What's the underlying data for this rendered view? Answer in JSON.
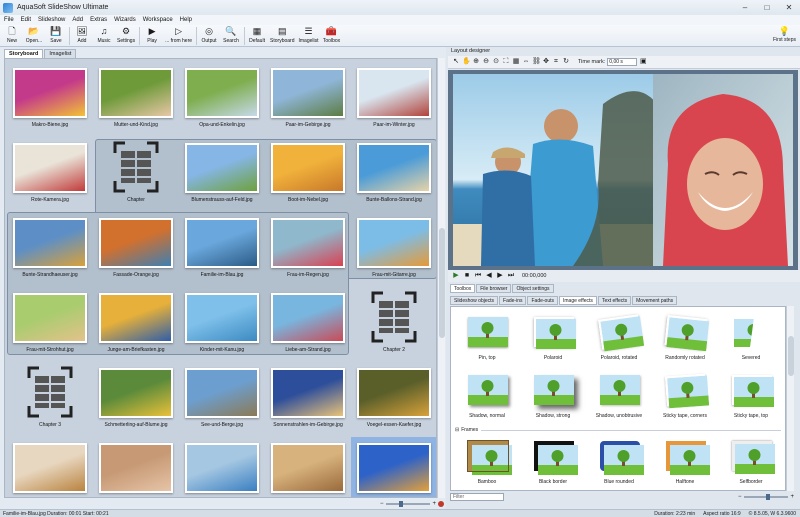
{
  "window": {
    "title": "AquaSoft SlideShow Ultimate",
    "minimize": "–",
    "maximize": "□",
    "close": "✕"
  },
  "menu": [
    "File",
    "Edit",
    "Slideshow",
    "Add",
    "Extras",
    "Wizards",
    "Workspace",
    "Help"
  ],
  "toolbar": [
    {
      "label": "New",
      "icon": "new-file-icon",
      "glyph": "🗋"
    },
    {
      "label": "Open...",
      "icon": "open-folder-icon",
      "glyph": "📂"
    },
    {
      "label": "Save",
      "icon": "save-icon",
      "glyph": "💾"
    },
    {
      "label": "Add",
      "icon": "add-image-icon",
      "glyph": "🖼"
    },
    {
      "label": "Music",
      "icon": "music-icon",
      "glyph": "♫"
    },
    {
      "label": "Settings",
      "icon": "settings-gear-icon",
      "glyph": "⚙"
    },
    {
      "label": "Play",
      "icon": "play-icon",
      "glyph": "▶"
    },
    {
      "label": "... from here",
      "icon": "play-from-here-icon",
      "glyph": "▷"
    },
    {
      "label": "Output",
      "icon": "output-icon",
      "glyph": "◎"
    },
    {
      "label": "Search",
      "icon": "search-icon",
      "glyph": "🔍"
    },
    {
      "label": "Default",
      "icon": "default-layout-icon",
      "glyph": "▦"
    },
    {
      "label": "Storyboard",
      "icon": "storyboard-icon",
      "glyph": "▤"
    },
    {
      "label": "Imagelist",
      "icon": "imagelist-icon",
      "glyph": "☰"
    },
    {
      "label": "Toolbox",
      "icon": "toolbox-icon",
      "glyph": "🧰"
    }
  ],
  "first_steps": {
    "label": "First steps",
    "icon": "lightbulb-icon",
    "glyph": "💡"
  },
  "left_tabs": [
    "Storyboard",
    "Imagelist"
  ],
  "storyboard": [
    {
      "caption": "Makro-Biene.jpg",
      "type": "photo",
      "c1": "#c43a8a",
      "c2": "#f2c236"
    },
    {
      "caption": "Mutter-und-Kind.jpg",
      "type": "photo",
      "c1": "#6e9a3a",
      "c2": "#e8c7a7"
    },
    {
      "caption": "Opa-und-Enkelin.jpg",
      "type": "photo",
      "c1": "#7fae4f",
      "c2": "#c7d9ea"
    },
    {
      "caption": "Paar-im-Gebirge.jpg",
      "type": "photo",
      "c1": "#8fb6d8",
      "c2": "#5d7c43"
    },
    {
      "caption": "Paar-im-Winter.jpg",
      "type": "photo",
      "c1": "#d9e6f0",
      "c2": "#b2433a"
    },
    {
      "caption": "Rote-Kamera.jpg",
      "type": "photo",
      "c1": "#e9e3d8",
      "c2": "#c13a3a"
    },
    {
      "caption": "Chapter",
      "type": "chapter"
    },
    {
      "caption": "Blumenstrauss-auf-Feld.jpg",
      "type": "photo",
      "c1": "#86b6e6",
      "c2": "#6ea13c"
    },
    {
      "caption": "Boot-im-Nebel.jpg",
      "type": "photo",
      "c1": "#f1b23b",
      "c2": "#c8782a"
    },
    {
      "caption": "Bunte-Ballons-Strand.jpg",
      "type": "photo",
      "c1": "#4a9bd8",
      "c2": "#e6d3a8"
    },
    {
      "caption": "Bunte-Strandhaeuser.jpg",
      "type": "photo",
      "c1": "#5d8fc6",
      "c2": "#d9a13a"
    },
    {
      "caption": "Fassade-Orange.jpg",
      "type": "photo",
      "c1": "#d2702e",
      "c2": "#3f7fb1"
    },
    {
      "caption": "Familie-im-Blau.jpg",
      "type": "photo",
      "c1": "#6aa7dc",
      "c2": "#2b5b86"
    },
    {
      "caption": "Frau-im-Regen.jpg",
      "type": "photo",
      "c1": "#8fb8cc",
      "c2": "#d84152"
    },
    {
      "caption": "Frau-mit-Gitarre.jpg",
      "type": "photo",
      "c1": "#7cbde8",
      "c2": "#e79a37"
    },
    {
      "caption": "Frau-mit-Strohhut.jpg",
      "type": "photo",
      "c1": "#a9cc6f",
      "c2": "#e3c28b"
    },
    {
      "caption": "Junge-am-Briefkasten.jpg",
      "type": "photo",
      "c1": "#e6b03a",
      "c2": "#2f5ea8"
    },
    {
      "caption": "Kinder-mit-Kanu.jpg",
      "type": "photo",
      "c1": "#7ec0ea",
      "c2": "#3c8ac2"
    },
    {
      "caption": "Liebe-am-Strand.jpg",
      "type": "photo",
      "c1": "#79b6df",
      "c2": "#c94b57"
    },
    {
      "caption": "Chapter 2",
      "type": "chapter"
    },
    {
      "caption": "Chapter 3",
      "type": "chapter"
    },
    {
      "caption": "Schmetterling-auf-Blume.jpg",
      "type": "photo",
      "c1": "#5a8a3a",
      "c2": "#e9c13a"
    },
    {
      "caption": "See-und-Berge.jpg",
      "type": "photo",
      "c1": "#6c9fd0",
      "c2": "#8b7a56"
    },
    {
      "caption": "Sonnenstrahlen-im-Gebirge.jpg",
      "type": "photo",
      "c1": "#2d4e9b",
      "c2": "#e9c37a"
    },
    {
      "caption": "Voegel-essen-Kaefer.jpg",
      "type": "photo",
      "c1": "#5a5f2a",
      "c2": "#d8a23a"
    },
    {
      "caption": "",
      "type": "photo",
      "c1": "#e8d7c0",
      "c2": "#b9833f"
    },
    {
      "caption": "",
      "type": "photo",
      "c1": "#c79a75",
      "c2": "#e6c4a8"
    },
    {
      "caption": "",
      "type": "photo",
      "c1": "#a5c7e2",
      "c2": "#3a7fc2"
    },
    {
      "caption": "",
      "type": "photo",
      "c1": "#d7b27d",
      "c2": "#9a6a3b"
    },
    {
      "caption": "",
      "type": "photo",
      "c1": "#2d62c9",
      "c2": "#e3a03a"
    }
  ],
  "layout_designer": {
    "title": "Layout designer",
    "time_mark_label": "Time mark:",
    "time_mark_value": "0,00 s"
  },
  "player": {
    "time": "00:00,000"
  },
  "right_tabs_top": [
    "Toolbox",
    "File browser",
    "Object settings"
  ],
  "right_tabs_effects": [
    "Slideshow objects",
    "Fade-ins",
    "Fade-outs",
    "Image effects",
    "Text effects",
    "Movement paths"
  ],
  "effects_row1": [
    "Pin, top",
    "Polaroid",
    "Polaroid, rotated",
    "Randomly rotated",
    "Severed"
  ],
  "effects_row2": [
    "Shadow, normal",
    "Shadow, strong",
    "Shadow, unobtrusive",
    "Sticky tape, corners",
    "Sticky tape, top"
  ],
  "frames_heading": "Frames",
  "frames_row": [
    "Bamboo",
    "Black border",
    "Blue rounded",
    "Halftone",
    "Selfborder"
  ],
  "filter_placeholder": "Filter",
  "status": {
    "left": "Familie-im-Blau.jpg   Duration: 00:01   Start: 00:21",
    "duration": "Duration: 2:23 min",
    "aspect": "Aspect ratio 16:9",
    "version": "© 8.5.05, W 6.3.9600"
  }
}
